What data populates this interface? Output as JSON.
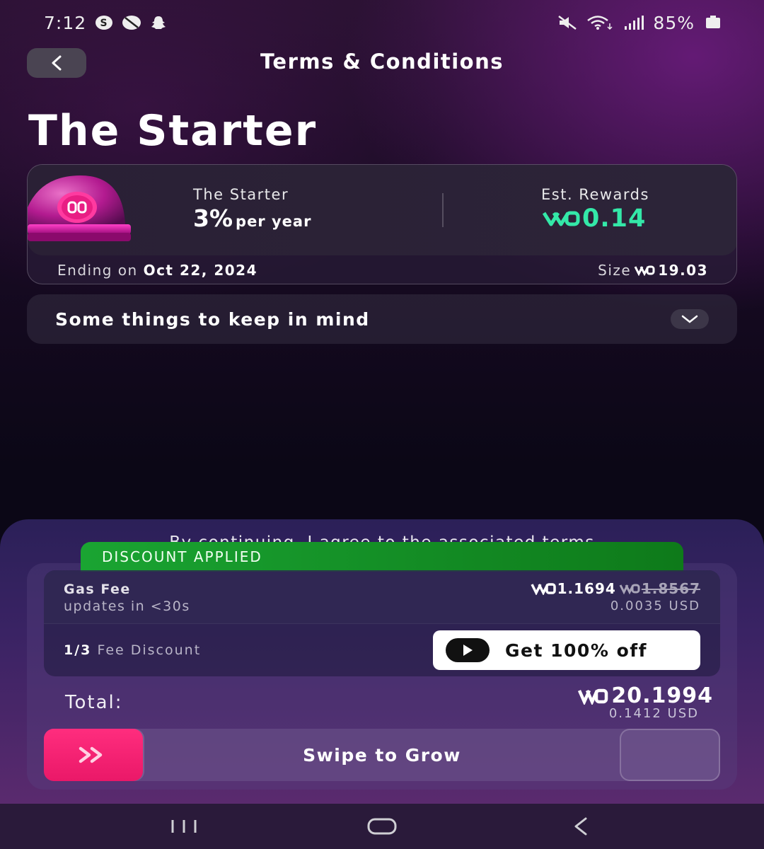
{
  "status_bar": {
    "time": "7:12",
    "battery_percent": "85%",
    "left_icons": [
      "threads-icon",
      "no-facetime-icon",
      "snapchat-icon"
    ],
    "right_icons": [
      "mute-icon",
      "wifi-icon",
      "signal-icon",
      "battery-icon"
    ]
  },
  "header": {
    "back_icon": "chevron-left-icon",
    "title": "Terms & Conditions"
  },
  "page_title": "The Starter",
  "vault": {
    "icon": "vault-dome-icon",
    "name": "The Starter",
    "rate": "3%",
    "rate_unit": "per year",
    "rewards_label": "Est. Rewards",
    "rewards_value": "0.14",
    "ending_prefix": "Ending on",
    "ending_date": "Oct 22, 2024",
    "size_label": "Size",
    "size_value": "19.03"
  },
  "keep_in_mind": {
    "title": "Some things to keep in mind",
    "expand_icon": "chevron-down-icon"
  },
  "agreement_text": "By continuing, I agree to the associated terms",
  "discount_banner": "DISCOUNT APPLIED",
  "gas_fee": {
    "label": "Gas Fee",
    "subtitle": "updates in <30s",
    "amount": "1.1694",
    "original_amount": "1.8567",
    "usd": "0.0035 USD"
  },
  "fee_discount": {
    "count": "1/3",
    "label": "Fee Discount",
    "button_label": "Get 100% off",
    "button_icon": "play-icon"
  },
  "total": {
    "label": "Total:",
    "amount": "20.1994",
    "usd": "0.1412 USD"
  },
  "swipe": {
    "label": "Swipe to Grow",
    "handle_icon": "double-chevron-right-icon"
  },
  "nav_bar": {
    "icons": [
      "recent-apps-icon",
      "home-icon",
      "back-icon"
    ]
  },
  "colors": {
    "accent_green": "#34e8a8",
    "discount_green": "#1aa432",
    "swipe_pink": "#ff2d7e",
    "background": "#0b0716"
  }
}
